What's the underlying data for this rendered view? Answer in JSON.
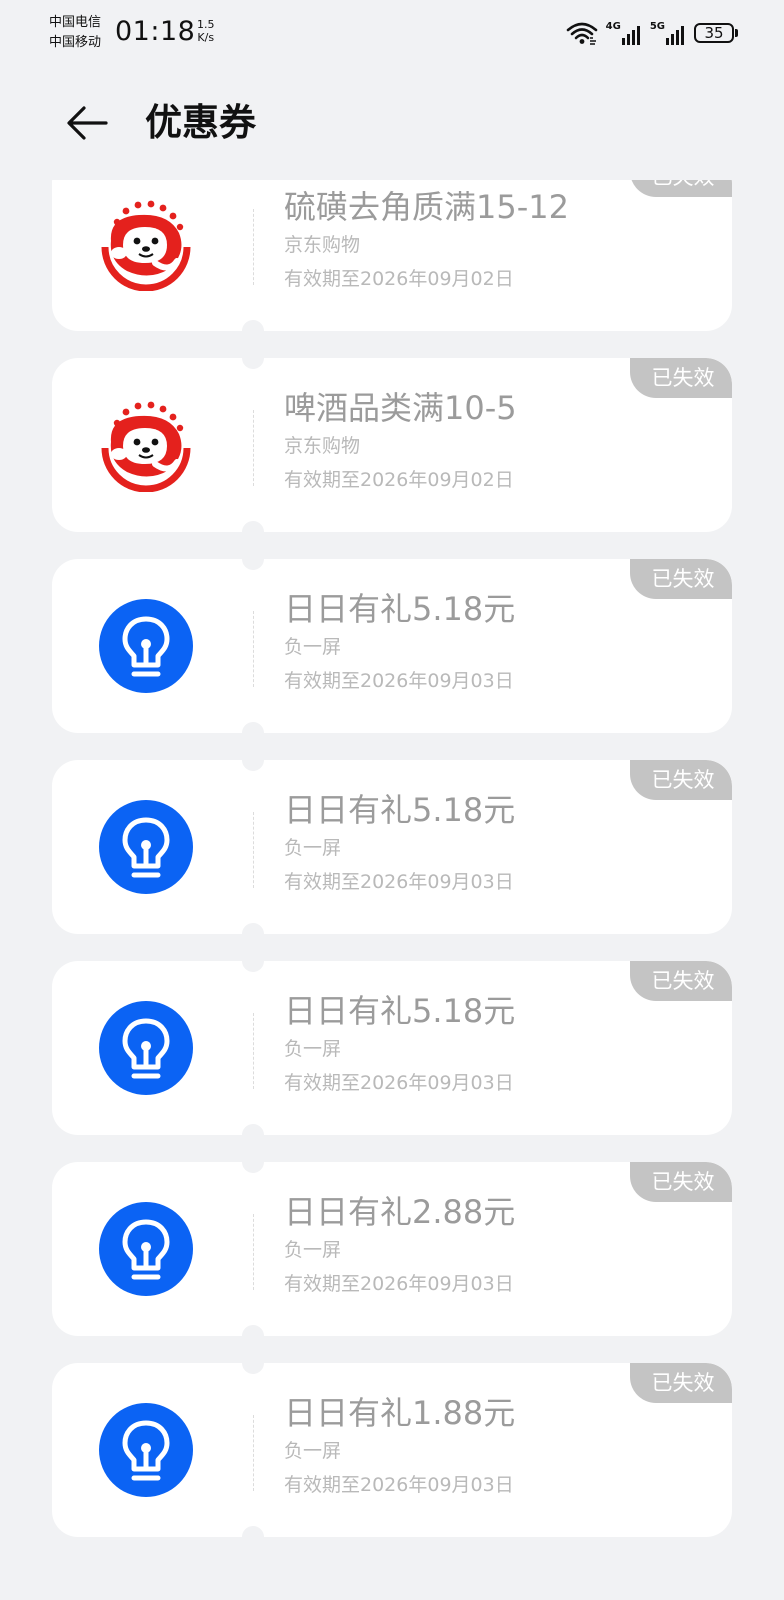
{
  "status_bar": {
    "carrier_1": "中国电信",
    "carrier_2": "中国移动",
    "time": "01:18",
    "net_speed_value": "1.5",
    "net_speed_unit": "K/s",
    "signal_1_type": "4G",
    "signal_2_type": "5G",
    "battery_level": "35",
    "icons": [
      "wifi-icon",
      "cellular-signal-icon",
      "cellular-signal-icon",
      "battery-icon"
    ]
  },
  "header": {
    "back_icon": "arrow-left-icon",
    "title": "优惠券"
  },
  "coupons": [
    {
      "title": "硫磺去角质满15-12",
      "source": "京东购物",
      "validity": "有效期至2026年09月02日",
      "status": "已失效",
      "icon": "jd-mascot-icon"
    },
    {
      "title": "啤酒品类满10-5",
      "source": "京东购物",
      "validity": "有效期至2026年09月02日",
      "status": "已失效",
      "icon": "jd-mascot-icon"
    },
    {
      "title": "日日有礼5.18元",
      "source": "负一屏",
      "validity": "有效期至2026年09月03日",
      "status": "已失效",
      "icon": "lightbulb-icon"
    },
    {
      "title": "日日有礼5.18元",
      "source": "负一屏",
      "validity": "有效期至2026年09月03日",
      "status": "已失效",
      "icon": "lightbulb-icon"
    },
    {
      "title": "日日有礼5.18元",
      "source": "负一屏",
      "validity": "有效期至2026年09月03日",
      "status": "已失效",
      "icon": "lightbulb-icon"
    },
    {
      "title": "日日有礼2.88元",
      "source": "负一屏",
      "validity": "有效期至2026年09月03日",
      "status": "已失效",
      "icon": "lightbulb-icon"
    },
    {
      "title": "日日有礼1.88元",
      "source": "负一屏",
      "validity": "有效期至2026年09月03日",
      "status": "已失效",
      "icon": "lightbulb-icon"
    }
  ],
  "colors": {
    "background": "#f1f2f4",
    "card": "#ffffff",
    "badge": "#c4c4c4",
    "title_text": "#9b9b9b",
    "meta_text": "#b9b9b9",
    "jd_red": "#e4211d",
    "bulb_blue": "#0b63f4"
  }
}
